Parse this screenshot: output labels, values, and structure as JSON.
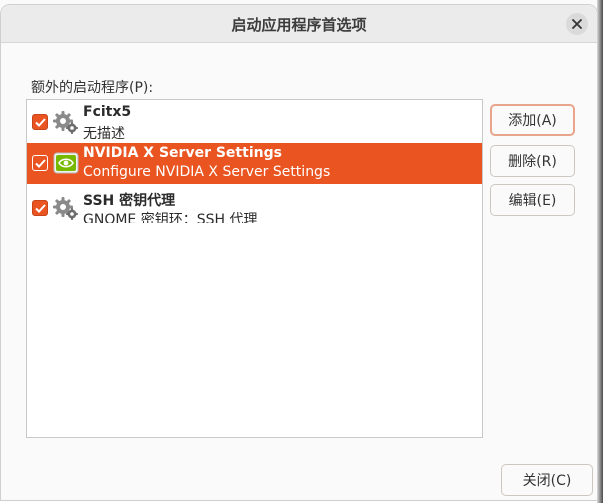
{
  "dialog": {
    "title": "启动应用程序首选项",
    "close_icon": "close-icon"
  },
  "list": {
    "label": "额外的启动程序(P):",
    "items": [
      {
        "name": "Fcitx5",
        "description": "无描述",
        "checked": true,
        "icon": "gear-icon",
        "selected": false
      },
      {
        "name": "NVIDIA X Server Settings",
        "description": "Configure NVIDIA X Server Settings",
        "checked": true,
        "icon": "nvidia-icon",
        "selected": true
      },
      {
        "name": "SSH 密钥代理",
        "description": "GNOME 密钥环：SSH 代理",
        "checked": true,
        "icon": "gear-icon",
        "selected": false
      }
    ]
  },
  "buttons": {
    "add": "添加(A)",
    "remove": "删除(R)",
    "edit": "编辑(E)",
    "close": "关闭(C)"
  },
  "colors": {
    "accent": "#e95420",
    "nvidia_green": "#76b900"
  }
}
